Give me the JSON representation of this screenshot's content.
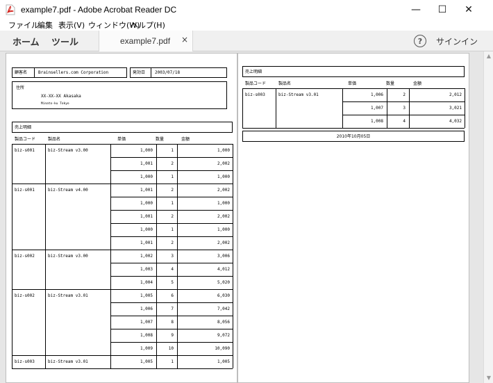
{
  "window": {
    "title": "example7.pdf - Adobe Acrobat Reader DC",
    "min_glyph": "—",
    "max_glyph": "☐",
    "close_glyph": "✕"
  },
  "menu": [
    "ファイル",
    "編集",
    "表示(V)",
    "ウィンドウ(W)",
    "ヘルプ(H)"
  ],
  "toolbar": {
    "home": "ホーム",
    "tools": "ツール",
    "tab_label": "example7.pdf",
    "tab_close": "×",
    "help": "?",
    "sign_in": "サインイン"
  },
  "page1": {
    "customer_label": "顧客名",
    "customer_value": "Brainsellers.com Corporation",
    "date_label": "発効日",
    "date_value": "2003/07/18",
    "address_label": "住所",
    "address_line1": "XX-XX-XX Akasaka",
    "address_line2": "Minato-ku Tokyo",
    "section_title": "売上明細",
    "headers": [
      "製品コード",
      "製品名",
      "単価",
      "数量",
      "金額"
    ],
    "groups": [
      {
        "code": "biz-s001",
        "name": "biz-Stream v3.00",
        "rows": [
          [
            "1,000",
            "1",
            "1,000"
          ],
          [
            "1,001",
            "2",
            "2,002"
          ],
          [
            "1,000",
            "1",
            "1,000"
          ]
        ]
      },
      {
        "code": "biz-s001",
        "name": "biz-Stream v4.00",
        "rows": [
          [
            "1,001",
            "2",
            "2,002"
          ],
          [
            "1,000",
            "1",
            "1,000"
          ],
          [
            "1,001",
            "2",
            "2,002"
          ],
          [
            "1,000",
            "1",
            "1,000"
          ],
          [
            "1,001",
            "2",
            "2,002"
          ]
        ]
      },
      {
        "code": "biz-s002",
        "name": "biz-Stream v3.00",
        "rows": [
          [
            "1,002",
            "3",
            "3,006"
          ],
          [
            "1,003",
            "4",
            "4,012"
          ],
          [
            "1,004",
            "5",
            "5,020"
          ]
        ]
      },
      {
        "code": "biz-s002",
        "name": "biz-Stream v3.01",
        "rows": [
          [
            "1,005",
            "6",
            "6,030"
          ],
          [
            "1,006",
            "7",
            "7,042"
          ],
          [
            "1,007",
            "8",
            "8,056"
          ],
          [
            "1,008",
            "9",
            "9,072"
          ],
          [
            "1,009",
            "10",
            "10,090"
          ]
        ]
      },
      {
        "code": "biz-s003",
        "name": "biz-Stream v3.01",
        "rows": [
          [
            "1,005",
            "1",
            "1,005"
          ]
        ]
      }
    ]
  },
  "page2": {
    "section_title": "売上明細",
    "headers": [
      "製品コード",
      "製品名",
      "単価",
      "数量",
      "金額"
    ],
    "groups": [
      {
        "code": "biz-s003",
        "name": "biz-Stream v3.01",
        "rows": [
          [
            "1,006",
            "2",
            "2,012"
          ],
          [
            "1,007",
            "3",
            "3,021"
          ],
          [
            "1,008",
            "4",
            "4,032"
          ]
        ]
      }
    ],
    "footer_date": "2010年10月05日"
  }
}
